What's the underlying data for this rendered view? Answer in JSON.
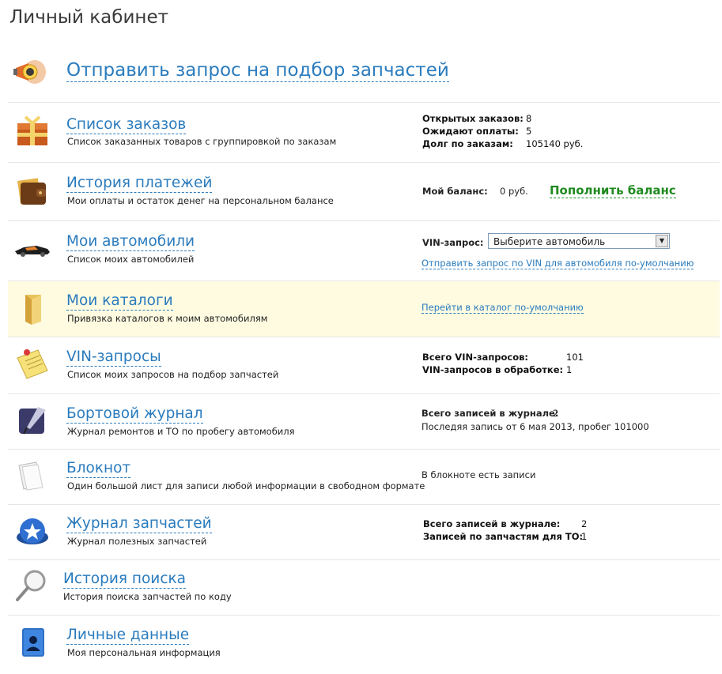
{
  "page_title": "Личный кабинет",
  "hero": {
    "label": "Отправить запрос на подбор запчастей",
    "icon": "megaphone-icon"
  },
  "rows": {
    "orders": {
      "title": "Список заказов",
      "desc": "Список заказанных товаров с группировкой по заказам",
      "icon": "gift-box-icon",
      "stats": [
        {
          "k": "Открытых заказов:",
          "v": "8"
        },
        {
          "k": "Ожидают оплаты:",
          "v": "5"
        },
        {
          "k": "Долг по заказам:",
          "v": "105140 руб."
        }
      ]
    },
    "payments": {
      "title": "История платежей",
      "desc": "Мои оплаты и остаток денег на персональном балансе",
      "icon": "wallet-icon",
      "balance_label": "Мой баланс:",
      "balance_value": "0 руб.",
      "topup_label": "Пополнить баланс"
    },
    "cars": {
      "title": "Мои автомобили",
      "desc": "Список моих автомобилей",
      "icon": "car-icon",
      "vin_label": "VIN-запрос:",
      "vin_select": "Выберите автомобиль",
      "vin_link": "Отправить запрос по VIN для автомобиля по-умолчанию"
    },
    "catalogs": {
      "title": "Мои каталоги",
      "desc": "Привязка каталогов к моим автомобилям",
      "icon": "folder-icon",
      "link": "Перейти в каталог по-умолчанию"
    },
    "vin": {
      "title": "VIN-запросы",
      "desc": "Список моих запросов на подбор запчастей",
      "icon": "notepad-pin-icon",
      "stats": [
        {
          "k": "Всего VIN-запросов:",
          "v": "101"
        },
        {
          "k": "VIN-запросов в обработке:",
          "v": "1"
        }
      ]
    },
    "logbook": {
      "title": "Бортовой журнал",
      "desc": "Журнал ремонтов и ТО по пробегу автомобиля",
      "icon": "quill-icon",
      "total_label": "Всего записей в журнале:",
      "total_value": "2",
      "last": "Последяя запись от 6 мая 2013, пробег 101000"
    },
    "notepad": {
      "title": "Блокнот",
      "desc": "Один большой лист для записи любой информации в свободном формате",
      "icon": "paper-sheet-icon",
      "info": "В блокноте есть записи"
    },
    "parts_log": {
      "title": "Журнал запчастей",
      "desc": "Журнал полезных запчастей",
      "icon": "star-badge-icon",
      "stats": [
        {
          "k": "Всего записей в журнале:",
          "v": "2"
        },
        {
          "k": "Записей по запчастям для ТО:",
          "v": "1"
        }
      ]
    },
    "search": {
      "title": "История поиска",
      "desc": "История поиска запчастей по коду",
      "icon": "magnifier-icon"
    },
    "personal": {
      "title": "Личные данные",
      "desc": "Моя персональная информация",
      "icon": "contact-book-icon"
    }
  },
  "colors": {
    "link": "#2a7bbd",
    "topup": "#1f8a1f",
    "highlight_row": "#fffbe1"
  }
}
